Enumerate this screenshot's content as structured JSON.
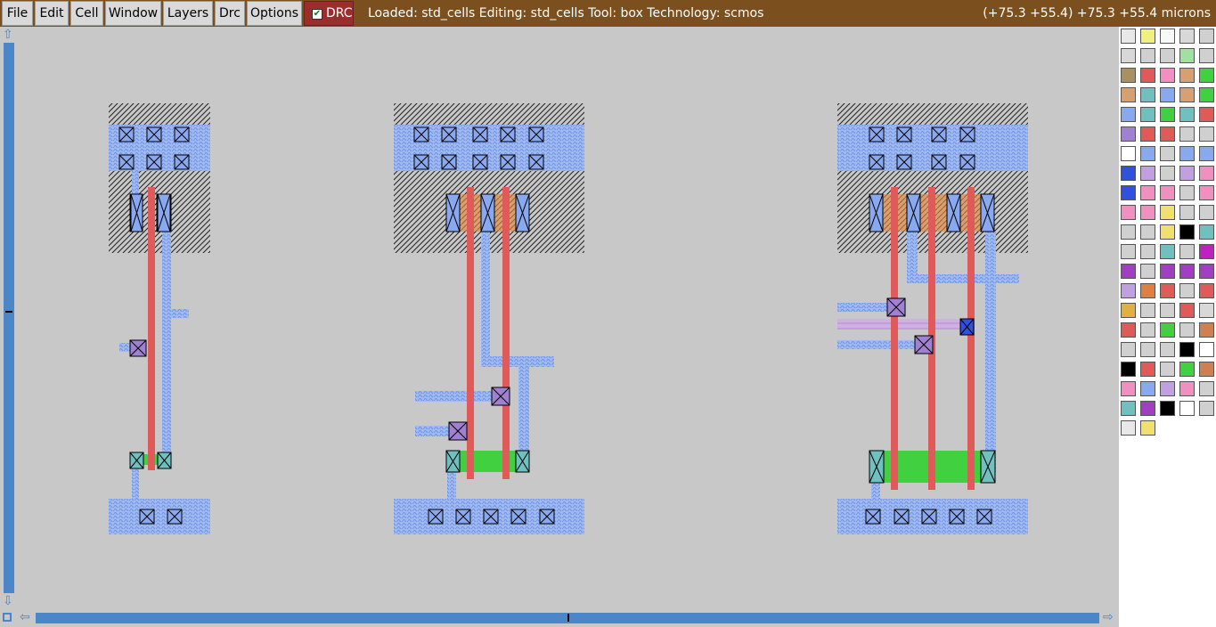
{
  "menu": {
    "file": "File",
    "edit": "Edit",
    "cell": "Cell",
    "window": "Window",
    "layers": "Layers",
    "drc": "Drc",
    "options": "Options"
  },
  "drc_toggle": {
    "label": "DRC",
    "checked": true
  },
  "status": {
    "left": "Loaded: std_cells Editing: std_cells Tool: box  Technology: scmos",
    "coords": "(+75.3 +55.4) +75.3 +55.4 microns"
  },
  "colors": {
    "title_bar": "#7b4f1e",
    "drc_button": "#9b2d2d",
    "scrollbar": "#4a86c8",
    "canvas": "#c8c8c8",
    "metal1": "#88a8f0",
    "poly": "#e05a5a",
    "ndiff": "#40d040",
    "pdiff": "#d0a070",
    "contact": "#70c0c0",
    "via": "#a080d0",
    "nwell": "#555555"
  },
  "icons": {
    "scroll_up": "arrow-up-icon",
    "scroll_down": "arrow-down-icon",
    "scroll_left": "arrow-left-icon",
    "scroll_right": "arrow-right-icon"
  },
  "layout_cells": [
    {
      "name": "cell-inverter"
    },
    {
      "name": "cell-nand2"
    },
    {
      "name": "cell-nand3"
    }
  ],
  "layer_palette": {
    "columns": 5,
    "swatches": [
      "#e8e8e8",
      "#f0f080",
      "#f8f8f8",
      "#d8d8d8",
      "#d0d0d0",
      "#d8d8d8",
      "#d0d0d0",
      "#d0d0d0",
      "#a0e0a0",
      "#d0d0d0",
      "#a89060",
      "#e05a5a",
      "#f090c0",
      "#d8a070",
      "#40d040",
      "#d8a070",
      "#70c0c0",
      "#88a8f0",
      "#d8a070",
      "#40d040",
      "#88a8f0",
      "#70c0c0",
      "#40d040",
      "#70c0c0",
      "#e05a5a",
      "#a080d0",
      "#e05a5a",
      "#e05a5a",
      "#d0d0d0",
      "#d0d0d0",
      "#ffffff",
      "#88a8f0",
      "#d0d0d0",
      "#88a8f0",
      "#88a8f0",
      "#3050e0",
      "#c0a0e0",
      "#d0d0d0",
      "#c0a0e0",
      "#f090c0",
      "#3050e0",
      "#f090c0",
      "#f090c0",
      "#d0d0d0",
      "#f090c0",
      "#f090c0",
      "#f090c0",
      "#f0e070",
      "#d0d0d0",
      "#d0d0d0",
      "#d0d0d0",
      "#d0d0d0",
      "#f0e070",
      "#000000",
      "#70c0c0",
      "#d0d0d0",
      "#d0d0d0",
      "#70c0c0",
      "#d0d0d0",
      "#c020c0",
      "#a040c0",
      "#d0d0d0",
      "#a040c0",
      "#a040c0",
      "#a040c0",
      "#c0a0e0",
      "#e08040",
      "#e05a5a",
      "#d0d0d0",
      "#e05a5a",
      "#e0b040",
      "#d0d0d0",
      "#d0d0d0",
      "#e05a5a",
      "#d8d8d8",
      "#e05a5a",
      "#d0d0d0",
      "#40d040",
      "#d0d0d0",
      "#d08050",
      "#d0d0d0",
      "#d0d0d0",
      "#d0d0d0",
      "#000000",
      "#ffffff",
      "#000000",
      "#e05a5a",
      "#d0d0d0",
      "#40d040",
      "#d08050",
      "#f090c0",
      "#88a8f0",
      "#c0a0e0",
      "#f090c0",
      "#d0d0d0",
      "#70c0c0",
      "#a040c0",
      "#000000",
      "#ffffff",
      "#d0d0d0",
      "#e8e8e8",
      "#f0e070"
    ]
  }
}
